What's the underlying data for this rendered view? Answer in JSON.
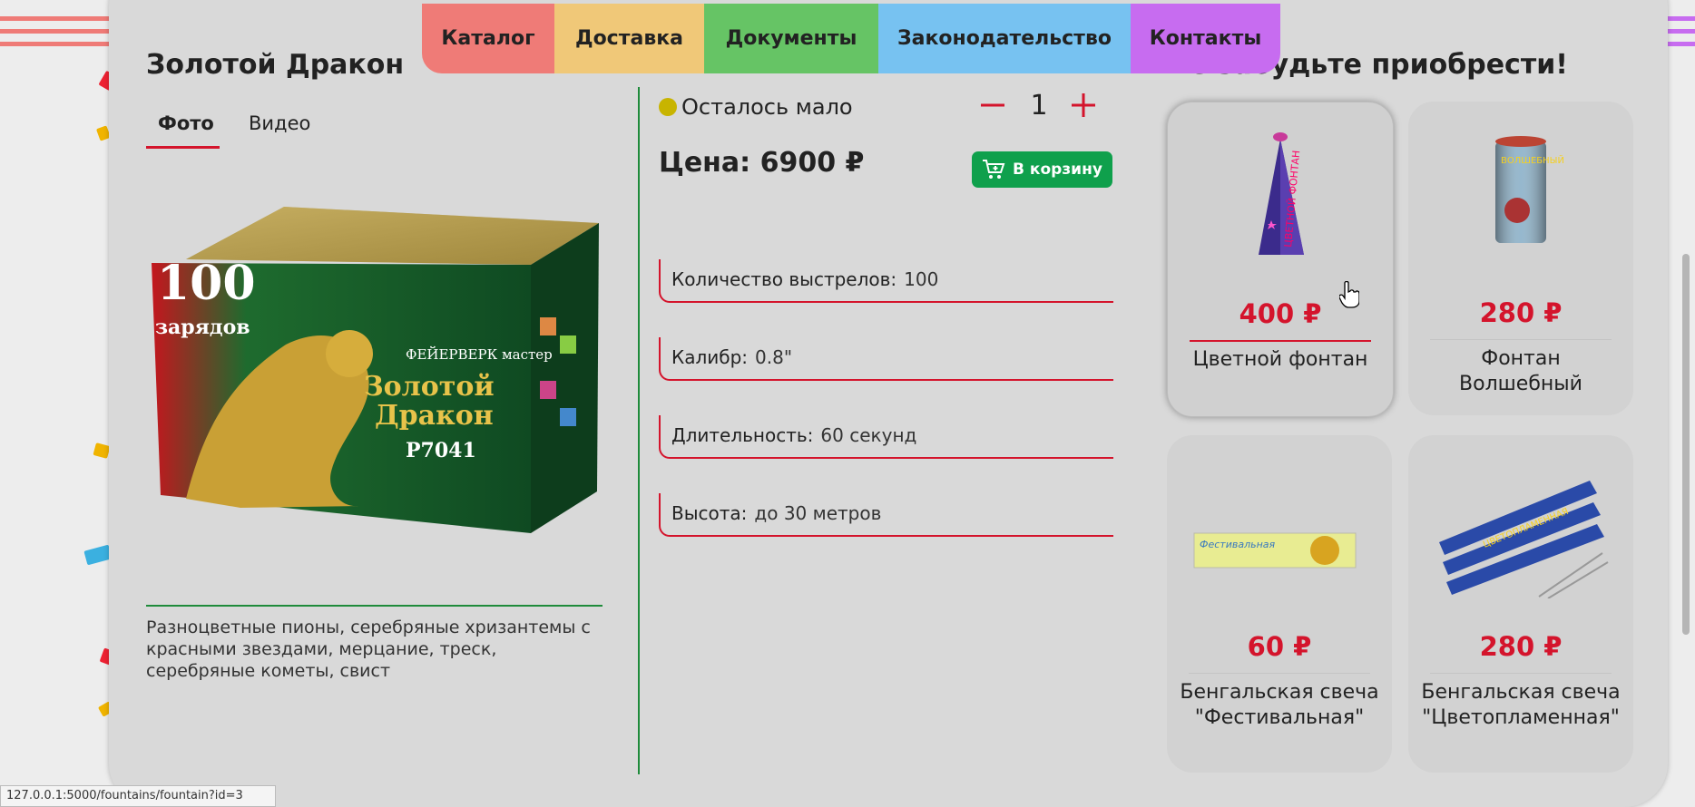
{
  "nav": {
    "items": [
      {
        "label": "Каталог",
        "color": "#ef7b77"
      },
      {
        "label": "Доставка",
        "color": "#f0c878"
      },
      {
        "label": "Документы",
        "color": "#66c465"
      },
      {
        "label": "Законодательство",
        "color": "#77c2f1"
      },
      {
        "label": "Контакты",
        "color": "#c76cf0"
      }
    ]
  },
  "product": {
    "title": "Золотой Дракон",
    "tabs": [
      {
        "label": "Фото",
        "active": true
      },
      {
        "label": "Видео",
        "active": false
      }
    ],
    "image": {
      "badge_number": "100",
      "badge_text": "зарядов",
      "brand": "ФЕЙЕРВЕРК мастер",
      "box_title_line1": "Золотой",
      "box_title_line2": "Дракон",
      "code": "Р7041"
    },
    "description": "Разноцветные пионы, серебряные хризантемы с красными звездами, мерцание, треск, серебряные кометы, свист",
    "stock_status": "Осталось мало",
    "stock_color": "#c8b400",
    "quantity": "1",
    "qty_minus": "−",
    "qty_plus": "+",
    "price": "Цена: 6900 ₽",
    "cart_label": "В корзину",
    "specs": [
      {
        "label": "Количество выстрелов:",
        "value": "100"
      },
      {
        "label": "Калибр:",
        "value": "0.8\""
      },
      {
        "label": "Длительность:",
        "value": "60 секунд"
      },
      {
        "label": "Высота:",
        "value": "до 30 метров"
      }
    ]
  },
  "recommendations": {
    "title": "Не забудьте приобрести!",
    "items": [
      {
        "price": "400 ₽",
        "name": "Цветной фонтан",
        "image_label": "ЦВЕТНОЙ ФОНТАН"
      },
      {
        "price": "280 ₽",
        "name": "Фонтан Волшебный",
        "image_label": "ВОЛШЕБНЫЙ"
      },
      {
        "price": "60 ₽",
        "name": "Бенгальская свеча \"Фестивальная\"",
        "image_label": "Фестивальная"
      },
      {
        "price": "280 ₽",
        "name": "Бенгальская свеча \"Цветопламенная\"",
        "image_label": "ЦВЕТОПЛАМЕННАЯ"
      }
    ]
  },
  "status_bar": {
    "url": "127.0.0.1:5000/fountains/fountain?id=3"
  },
  "colors": {
    "accent_red": "#d4142c",
    "accent_green": "#1f8b3b",
    "cart_green": "#0fa04c"
  }
}
